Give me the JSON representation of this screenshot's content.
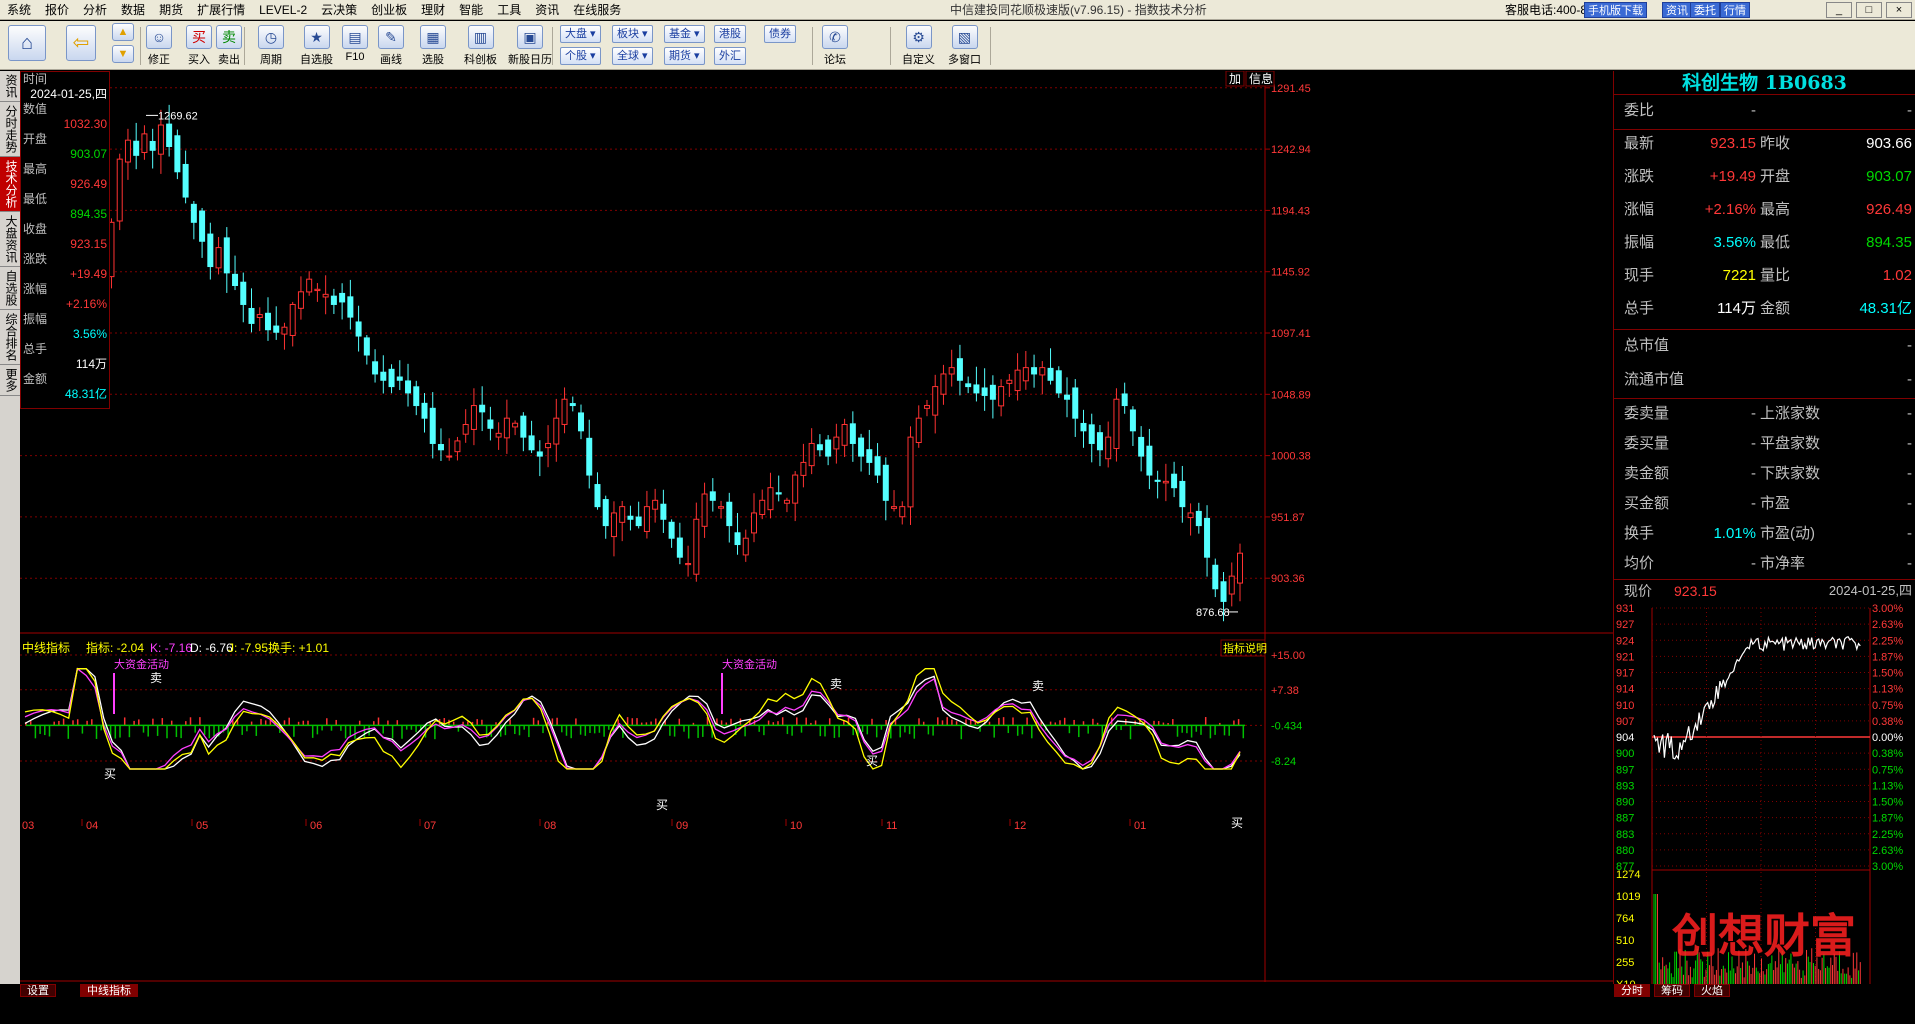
{
  "menu": [
    "系统",
    "报价",
    "分析",
    "数据",
    "期货",
    "扩展行情",
    "LEVEL-2",
    "云决策",
    "创业板",
    "理财",
    "智能",
    "工具",
    "资讯",
    "在线服务"
  ],
  "app_title": "中信建投同花顺极速版(v7.96.15) - 指数技术分析",
  "hotline": "客服电话:400-8888-108",
  "top_buttons": [
    "手机版下载",
    "资讯",
    "委托",
    "行情"
  ],
  "toolbar": {
    "items": [
      "修正",
      "买入",
      "卖出",
      "周期",
      "自选股",
      "F10",
      "画线",
      "选股",
      "科创板",
      "新股日历",
      "论坛",
      "自定义",
      "多窗口"
    ],
    "small_buttons": [
      "大盘",
      "个股",
      "板块",
      "全球",
      "基金",
      "期货",
      "港股",
      "外汇",
      "债券"
    ]
  },
  "left_tabs": [
    "资讯",
    "分时走势",
    "技术分析",
    "大盘资讯",
    "自选股",
    "综合排名",
    "更多"
  ],
  "datawin": {
    "rows": [
      {
        "label": "时间",
        "value": "2024-01-25,四",
        "color": "#ffffff"
      },
      {
        "label": "数值",
        "value": "1032.30",
        "color": "#ff3838"
      },
      {
        "label": "开盘",
        "value": "903.07",
        "color": "#00d800"
      },
      {
        "label": "最高",
        "value": "926.49",
        "color": "#ff3838"
      },
      {
        "label": "最低",
        "value": "894.35",
        "color": "#00d800"
      },
      {
        "label": "收盘",
        "value": "923.15",
        "color": "#ff3838"
      },
      {
        "label": "涨跌",
        "value": "+19.49",
        "color": "#ff3838"
      },
      {
        "label": "涨幅",
        "value": "+2.16%",
        "color": "#ff3838"
      },
      {
        "label": "振幅",
        "value": "3.56%",
        "color": "#00ffff"
      },
      {
        "label": "总手",
        "value": "114万",
        "color": "#ffffff"
      },
      {
        "label": "金额",
        "value": "48.31亿",
        "color": "#00ffff"
      }
    ]
  },
  "chart_header": {
    "add": "加",
    "info": "信息"
  },
  "main_axis": [
    "1291.45",
    "1242.94",
    "1194.43",
    "1145.92",
    "1097.41",
    "1048.89",
    "1000.38",
    "951.87",
    "903.36"
  ],
  "annotations": {
    "high": "1269.62",
    "low": "876.68"
  },
  "indicator": {
    "title": "中线指标",
    "v1": "指标: -2.04",
    "v2": "K: -7.16",
    "v3": "D: -6.76",
    "v4": "J: -7.95",
    "v5": "换手: +1.01",
    "explain": "指标说明",
    "axis": [
      "+15.00",
      "+7.38",
      "-0.434",
      "-8.24"
    ],
    "event_label": "大资金活动",
    "buy": "买",
    "sell": "卖"
  },
  "months": [
    "03",
    "04",
    "05",
    "06",
    "07",
    "08",
    "09",
    "10",
    "11",
    "12",
    "01"
  ],
  "bottom_tabs": [
    "设置",
    "中线指标"
  ],
  "stock": {
    "name": "科创生物",
    "code": "1B0683"
  },
  "quote": {
    "weibi": "委比",
    "weibi_val": "-",
    "weibi_val2": "-",
    "rows": [
      {
        "l1": "最新",
        "v1": "923.15",
        "c1": "#ff3838",
        "l2": "昨收",
        "v2": "903.66",
        "c2": "#ffffff"
      },
      {
        "l1": "涨跌",
        "v1": "+19.49",
        "c1": "#ff3838",
        "l2": "开盘",
        "v2": "903.07",
        "c2": "#00d800"
      },
      {
        "l1": "涨幅",
        "v1": "+2.16%",
        "c1": "#ff3838",
        "l2": "最高",
        "v2": "926.49",
        "c2": "#ff3838"
      },
      {
        "l1": "振幅",
        "v1": "3.56%",
        "c1": "#00ffff",
        "l2": "最低",
        "v2": "894.35",
        "c2": "#00d800"
      },
      {
        "l1": "现手",
        "v1": "7221",
        "c1": "#ffff00",
        "l2": "量比",
        "v2": "1.02",
        "c2": "#ff3838"
      },
      {
        "l1": "总手",
        "v1": "114万",
        "c1": "#ffffff",
        "l2": "金额",
        "v2": "48.31亿",
        "c2": "#00ffff"
      }
    ],
    "cap1": "总市值",
    "cap2": "流通市值",
    "rows2": [
      {
        "l1": "委卖量",
        "l2": "上涨家数"
      },
      {
        "l1": "委买量",
        "l2": "平盘家数"
      },
      {
        "l1": "卖金额",
        "l2": "下跌家数"
      },
      {
        "l1": "买金额",
        "l2": "市盈"
      },
      {
        "l1": "换手",
        "v1": "1.01%",
        "l2": "市盈(动)"
      },
      {
        "l1": "均价",
        "l2": "市净率"
      }
    ],
    "dash": "-"
  },
  "mini": {
    "label": "现价",
    "price": "923.15",
    "date": "2024-01-25,四",
    "left_axis": [
      "931",
      "927",
      "924",
      "921",
      "917",
      "914",
      "910",
      "907",
      "904",
      "900",
      "897",
      "893",
      "890",
      "887",
      "883",
      "880",
      "877"
    ],
    "right_axis": [
      "3.00%",
      "2.63%",
      "2.25%",
      "1.87%",
      "1.50%",
      "1.13%",
      "0.75%",
      "0.38%",
      "0.00%",
      "0.38%",
      "0.75%",
      "1.13%",
      "1.50%",
      "1.87%",
      "2.25%",
      "2.63%",
      "3.00%"
    ],
    "vol_axis": [
      "1274",
      "1019",
      "764",
      "510",
      "255",
      "X10"
    ],
    "tabs": [
      "分时",
      "筹码",
      "火焰"
    ],
    "watermark": "创想财富"
  },
  "chart_data": {
    "type": "candlestick",
    "ylim": [
      860,
      1300
    ],
    "months": [
      "03",
      "04",
      "05",
      "06",
      "07",
      "08",
      "09",
      "10",
      "11",
      "12",
      "01"
    ],
    "closes": [
      1130,
      1150,
      1185,
      1235,
      1250,
      1238,
      1255,
      1242,
      1262,
      1245,
      1225,
      1205,
      1185,
      1170,
      1150,
      1165,
      1145,
      1135,
      1120,
      1105,
      1112,
      1100,
      1098,
      1102,
      1120,
      1130,
      1140,
      1132,
      1128,
      1120,
      1122,
      1110,
      1095,
      1080,
      1065,
      1060,
      1055,
      1060,
      1050,
      1040,
      1030,
      1010,
      1005,
      1000,
      1012,
      1025,
      1040,
      1035,
      1022,
      1018,
      1030,
      1026,
      1015,
      1005,
      1000,
      1010,
      1030,
      1045,
      1040,
      1020,
      985,
      960,
      945,
      955,
      960,
      950,
      945,
      960,
      965,
      950,
      935,
      920,
      915,
      950,
      970,
      965,
      960,
      945,
      930,
      935,
      955,
      965,
      975,
      970,
      965,
      985,
      995,
      1010,
      1005,
      1000,
      1015,
      1025,
      1010,
      1000,
      995,
      985,
      965,
      960,
      960,
      1015,
      1030,
      1040,
      1055,
      1065,
      1070,
      1060,
      1055,
      1050,
      1048,
      1045,
      1055,
      1060,
      1068,
      1070,
      1065,
      1070,
      1060,
      1050,
      1045,
      1030,
      1020,
      1010,
      1005,
      1015,
      1045,
      1040,
      1020,
      1000,
      985,
      980,
      980,
      975,
      960,
      955,
      945,
      920,
      895,
      885,
      905,
      923.15
    ],
    "indicator": {
      "axis": [
        15.0,
        7.38,
        -0.434,
        -8.24
      ],
      "last": {
        "K": -7.16,
        "D": -6.76,
        "J": -7.95
      }
    },
    "high": 1269.62,
    "low": 876.68
  }
}
